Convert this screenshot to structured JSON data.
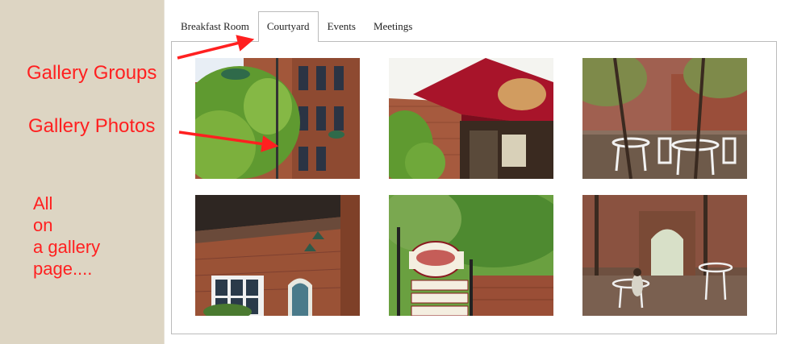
{
  "tabs": [
    {
      "label": "Breakfast Room",
      "active": false
    },
    {
      "label": "Courtyard",
      "active": true
    },
    {
      "label": "Events",
      "active": false
    },
    {
      "label": "Meetings",
      "active": false
    }
  ],
  "annotations": {
    "groups_label": "Gallery Groups",
    "photos_label": "Gallery Photos",
    "all_on_page_lines": [
      "All",
      "on",
      "a gallery",
      "page...."
    ],
    "color": "#ff2020"
  },
  "photos": [
    {
      "subject": "brick building with trees and lamps"
    },
    {
      "subject": "awning with Brookstown Inn sign"
    },
    {
      "subject": "courtyard with white tables and chairs"
    },
    {
      "subject": "covered patio with pendant lamps"
    },
    {
      "subject": "Brookstown Inn directional sign"
    },
    {
      "subject": "courtyard archway with seating"
    }
  ],
  "colors": {
    "background": "#ddd5c3",
    "page": "#ffffff",
    "border": "#bbbbbb",
    "accent": "#ff2020"
  }
}
